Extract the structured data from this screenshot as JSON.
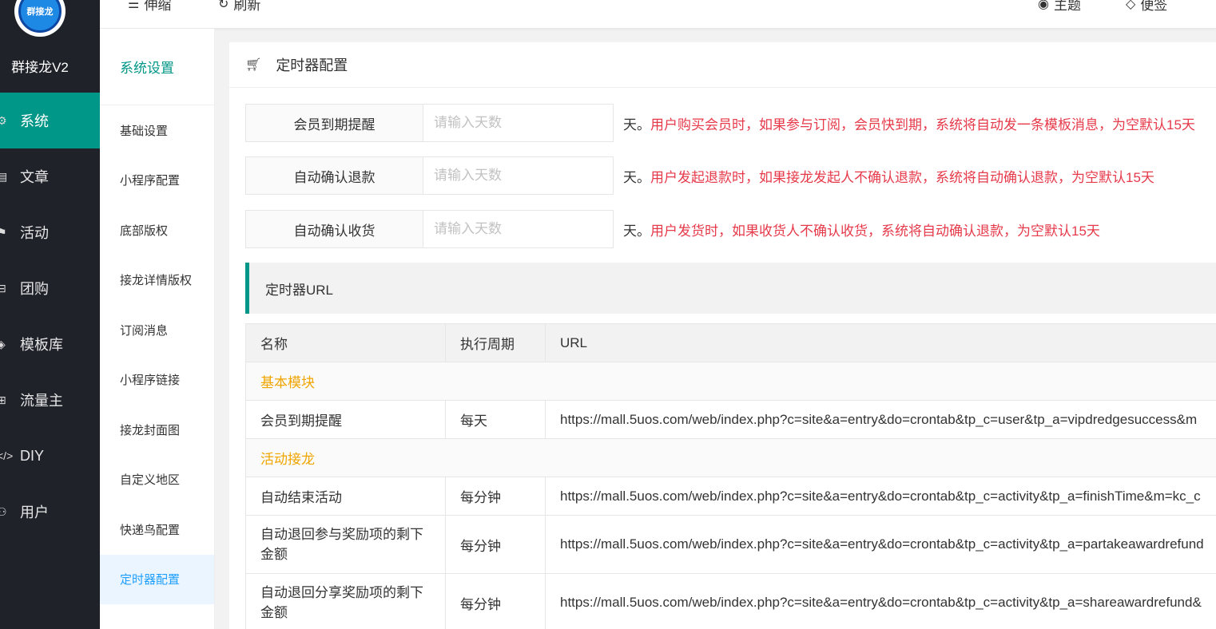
{
  "sidebar": {
    "logo_text": "群接龙",
    "brand": "群接龙V2",
    "items": [
      {
        "icon": "gear-icon",
        "glyph": "⚙",
        "label": "系统"
      },
      {
        "icon": "article-icon",
        "glyph": "▤",
        "label": "文章"
      },
      {
        "icon": "flag-icon",
        "glyph": "⚑",
        "label": "活动"
      },
      {
        "icon": "cart-icon",
        "glyph": "⊟",
        "label": "团购"
      },
      {
        "icon": "layers-icon",
        "glyph": "◈",
        "label": "模板库"
      },
      {
        "icon": "traffic-icon",
        "glyph": "⊞",
        "label": "流量主"
      },
      {
        "icon": "code-icon",
        "glyph": "</>",
        "label": "DIY"
      },
      {
        "icon": "user-icon",
        "glyph": "⚇",
        "label": "用户"
      }
    ]
  },
  "topbar": {
    "collapse_label": "伸缩",
    "refresh_label": "刷新",
    "theme_label": "主题",
    "note_label": "便签"
  },
  "subnav": {
    "title": "系统设置",
    "items": [
      "基础设置",
      "小程序配置",
      "底部版权",
      "接龙详情版权",
      "订阅消息",
      "小程序链接",
      "接龙封面图",
      "自定义地区",
      "快递鸟配置",
      "定时器配置"
    ]
  },
  "card": {
    "title": "定时器配置",
    "forms": [
      {
        "label": "会员到期提醒",
        "placeholder": "请输入天数",
        "unit": "天。",
        "hint": "用户购买会员时，如果参与订阅，会员快到期，系统将自动发一条模板消息，为空默认15天"
      },
      {
        "label": "自动确认退款",
        "placeholder": "请输入天数",
        "unit": "天。",
        "hint": "用户发起退款时，如果接龙发起人不确认退款，系统将自动确认退款，为空默认15天"
      },
      {
        "label": "自动确认收货",
        "placeholder": "请输入天数",
        "unit": "天。",
        "hint": "用户发货时，如果收货人不确认收货，系统将自动确认退款，为空默认15天"
      }
    ],
    "url_section_title": "定时器URL",
    "table": {
      "headers": [
        "名称",
        "执行周期",
        "URL"
      ],
      "groups": [
        {
          "name": "基本模块",
          "rows": [
            {
              "name": "会员到期提醒",
              "period": "每天",
              "url": "https://mall.5uos.com/web/index.php?c=site&a=entry&do=crontab&tp_c=user&tp_a=vipdredgesuccess&m"
            }
          ]
        },
        {
          "name": "活动接龙",
          "rows": [
            {
              "name": "自动结束活动",
              "period": "每分钟",
              "url": "https://mall.5uos.com/web/index.php?c=site&a=entry&do=crontab&tp_c=activity&tp_a=finishTime&m=kc_c"
            },
            {
              "name": "自动退回参与奖励项的剩下金额",
              "period": "每分钟",
              "url": "https://mall.5uos.com/web/index.php?c=site&a=entry&do=crontab&tp_c=activity&tp_a=partakeawardrefund"
            },
            {
              "name": "自动退回分享奖励项的剩下金额",
              "period": "每分钟",
              "url": "https://mall.5uos.com/web/index.php?c=site&a=entry&do=crontab&tp_c=activity&tp_a=shareawardrefund&"
            }
          ]
        }
      ]
    }
  },
  "colors": {
    "accent": "#009688",
    "sidebar_bg": "#20222a",
    "hint_red": "#e6394a",
    "group_orange": "#f0a500",
    "subnav_active": "#1e9fff"
  }
}
